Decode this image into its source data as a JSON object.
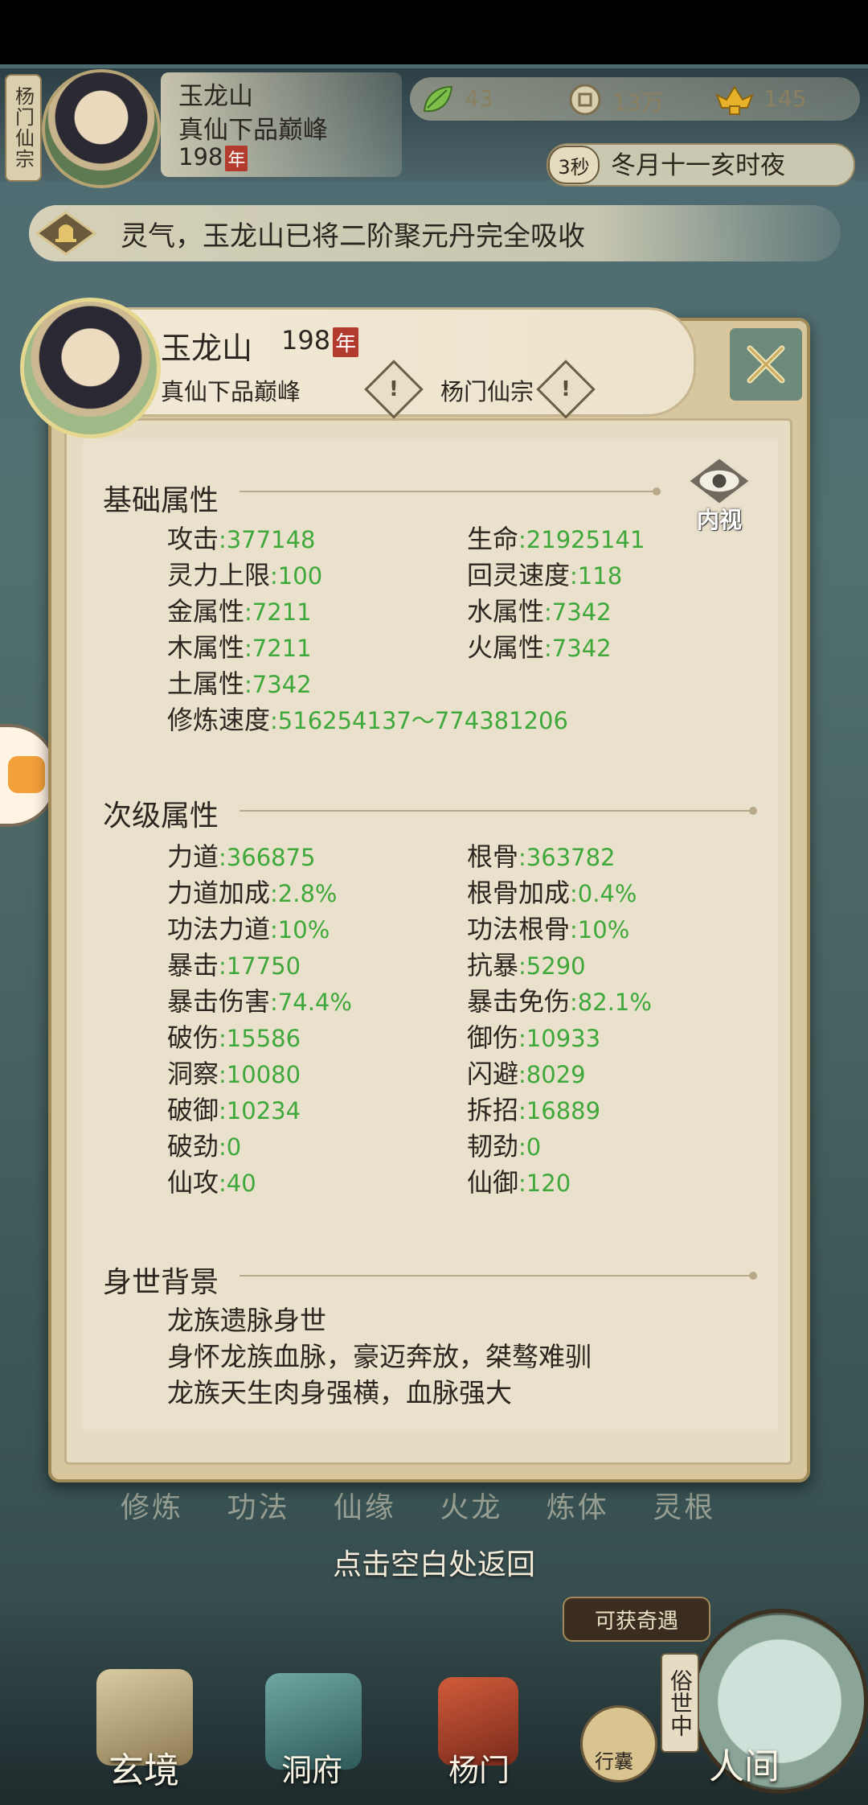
{
  "hud": {
    "sect_tag": "杨门仙宗",
    "player_name": "玉龙山",
    "player_rank": "真仙下品巅峰",
    "player_age": "198",
    "nian": "年",
    "resources": [
      {
        "icon": "leaf-icon",
        "value": "43"
      },
      {
        "icon": "coin-icon",
        "value": "13万"
      },
      {
        "icon": "ingot-icon",
        "value": "145"
      }
    ],
    "time_seconds": "3秒",
    "time_text": "冬月十一亥时夜",
    "notice": "灵气，玉龙山已将二阶聚元丹完全吸收"
  },
  "panel": {
    "name": "玉龙山",
    "age": "198",
    "nian": "年",
    "rank": "真仙下品巅峰",
    "sect": "杨门仙宗",
    "neishi": "内视",
    "basic": {
      "title": "基础属性",
      "left": [
        {
          "label": "攻击",
          "value": ":377148"
        },
        {
          "label": "灵力上限",
          "value": ":100"
        },
        {
          "label": "金属性",
          "value": ":7211"
        },
        {
          "label": "木属性",
          "value": ":7211"
        },
        {
          "label": "土属性",
          "value": ":7342"
        }
      ],
      "right": [
        {
          "label": "生命",
          "value": ":21925141"
        },
        {
          "label": "回灵速度",
          "value": ":118"
        },
        {
          "label": "水属性",
          "value": ":7342"
        },
        {
          "label": "火属性",
          "value": ":7342"
        }
      ],
      "speed_label": "修炼速度",
      "speed_value": ":516254137～774381206"
    },
    "secondary": {
      "title": "次级属性",
      "left": [
        {
          "label": "力道",
          "value": ":366875"
        },
        {
          "label": "力道加成",
          "value": ":2.8%"
        },
        {
          "label": "功法力道",
          "value": ":10%"
        },
        {
          "label": "暴击",
          "value": ":17750"
        },
        {
          "label": "暴击伤害",
          "value": ":74.4%"
        },
        {
          "label": "破伤",
          "value": ":15586"
        },
        {
          "label": "洞察",
          "value": ":10080"
        },
        {
          "label": "破御",
          "value": ":10234"
        },
        {
          "label": "破劲",
          "value": ":0"
        },
        {
          "label": "仙攻",
          "value": ":40"
        }
      ],
      "right": [
        {
          "label": "根骨",
          "value": ":363782"
        },
        {
          "label": "根骨加成",
          "value": ":0.4%"
        },
        {
          "label": "功法根骨",
          "value": ":10%"
        },
        {
          "label": "抗暴",
          "value": ":5290"
        },
        {
          "label": "暴击免伤",
          "value": ":82.1%"
        },
        {
          "label": "御伤",
          "value": ":10933"
        },
        {
          "label": "闪避",
          "value": ":8029"
        },
        {
          "label": "拆招",
          "value": ":16889"
        },
        {
          "label": "韧劲",
          "value": ":0"
        },
        {
          "label": "仙御",
          "value": ":120"
        }
      ]
    },
    "background": {
      "title": "身世背景",
      "lines": [
        "龙族遗脉身世",
        "身怀龙族血脉，豪迈奔放，桀骜难驯",
        "龙族天生肉身强横，血脉强大"
      ]
    }
  },
  "behind_tabs": "修炼 功法 仙缘 火龙 炼体 灵根",
  "return_hint": "点击空白处返回",
  "qiyu": "可获奇遇",
  "nav": {
    "xuanjing": "玄境",
    "dongfu": "洞府",
    "yangmen": "杨门",
    "xingnang": "行囊",
    "renjian": "人间",
    "sushi": "俗世中"
  },
  "colors": {
    "value_green": "#3fa83a",
    "panel_bg": "#eae1cc",
    "nian_red": "#b23b2e"
  }
}
